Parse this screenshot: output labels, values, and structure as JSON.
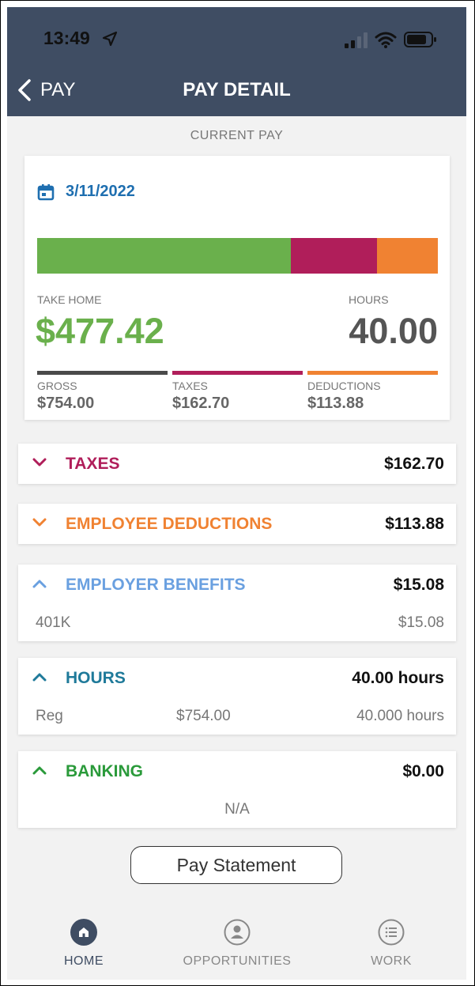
{
  "status_bar": {
    "time": "13:49"
  },
  "nav_bar": {
    "back_label": "PAY",
    "title": "PAY DETAIL"
  },
  "section_label": "CURRENT PAY",
  "pay_card": {
    "date": "3/11/2022",
    "take_home_label": "TAKE HOME",
    "take_home_value": "$477.42",
    "hours_label": "HOURS",
    "hours_value": "40.00",
    "breakdown_bar": [
      {
        "name": "take-home",
        "value": 477.42,
        "color": "#6ab04c"
      },
      {
        "name": "taxes",
        "value": 162.7,
        "color": "#b01e5a"
      },
      {
        "name": "deductions",
        "value": 113.88,
        "color": "#f08232"
      }
    ],
    "summary": [
      {
        "label": "GROSS",
        "value": "$754.00",
        "color": "#4a4a4a"
      },
      {
        "label": "TAXES",
        "value": "$162.70",
        "color": "#b01e5a"
      },
      {
        "label": "DEDUCTIONS",
        "value": "$113.88",
        "color": "#f08232"
      }
    ]
  },
  "sections": {
    "taxes": {
      "title": "TAXES",
      "amount": "$162.70",
      "color": "#b01e5a"
    },
    "deductions": {
      "title": "EMPLOYEE DEDUCTIONS",
      "amount": "$113.88",
      "color": "#f08232"
    },
    "benefits": {
      "title": "EMPLOYER BENEFITS",
      "amount": "$15.08",
      "color": "#6aa0e0",
      "rows": [
        {
          "name": "401K",
          "amount": "$15.08"
        }
      ]
    },
    "hours": {
      "title": "HOURS",
      "amount": "40.00 hours",
      "color": "#1f7a9a",
      "rows": [
        {
          "name": "Reg",
          "pay": "$754.00",
          "hours": "40.000 hours"
        }
      ]
    },
    "banking": {
      "title": "BANKING",
      "amount": "$0.00",
      "color": "#2a9a3a",
      "rows": [
        {
          "text": "N/A"
        }
      ]
    }
  },
  "pay_statement_button": "Pay Statement",
  "bottom_nav": [
    {
      "label": "HOME",
      "icon": "home-icon",
      "active": true
    },
    {
      "label": "OPPORTUNITIES",
      "icon": "person-icon",
      "active": false
    },
    {
      "label": "WORK",
      "icon": "list-icon",
      "active": false
    }
  ]
}
